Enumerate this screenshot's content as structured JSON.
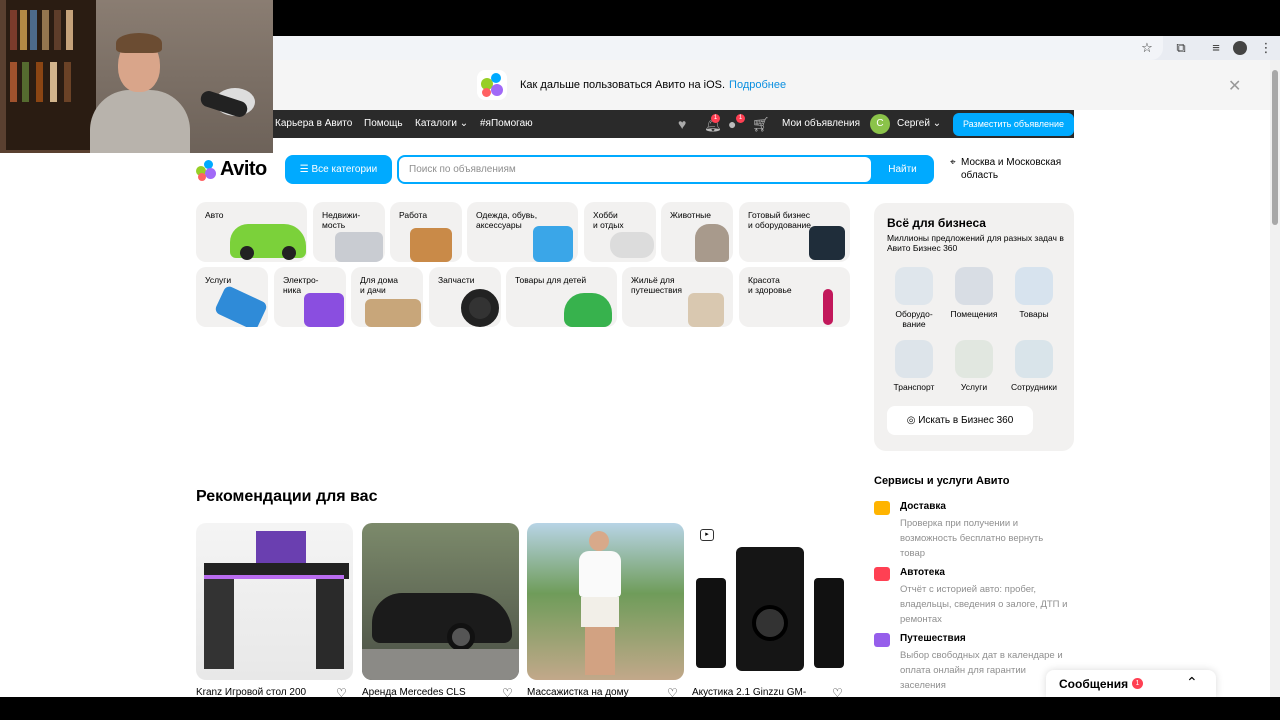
{
  "ios_banner": {
    "text": "Как дальше пользоваться Авито на iOS.",
    "link": "Подробнее"
  },
  "topnav": {
    "career": "Карьера в Авито",
    "help": "Помощь",
    "catalogs": "Каталоги ⌄",
    "hashtag": "#яПомогаю",
    "notif_badge": "1",
    "chat_badge": "1",
    "my_ads": "Мои объявления",
    "avatar_letter": "С",
    "user_name": "Сергей ⌄",
    "post_ad": "Разместить объявление"
  },
  "header": {
    "logo": "Avito",
    "all_categories": "Все категории",
    "search_placeholder": "Поиск по объявлениям",
    "search_button": "Найти",
    "location": "Москва и Московская область"
  },
  "categories": [
    {
      "label": "Авто"
    },
    {
      "label": "Недвижи-\nмость"
    },
    {
      "label": "Работа"
    },
    {
      "label": "Одежда, обувь,\nаксессуары"
    },
    {
      "label": "Хобби\nи отдых"
    },
    {
      "label": "Животные"
    },
    {
      "label": "Готовый бизнес\nи оборудование"
    },
    {
      "label": "Услуги"
    },
    {
      "label": "Электро-\nника"
    },
    {
      "label": "Для дома\nи дачи"
    },
    {
      "label": "Запчасти"
    },
    {
      "label": "Товары для детей"
    },
    {
      "label": "Жильё для\nпутешествия"
    },
    {
      "label": "Красота\nи здоровье"
    }
  ],
  "business": {
    "title": "Всё для бизнеса",
    "subtitle": "Миллионы предложений для разных задач в Авито Бизнес 360",
    "items": [
      {
        "label": "Оборудо-\nвание"
      },
      {
        "label": "Помещения"
      },
      {
        "label": "Товары"
      },
      {
        "label": "Транспорт"
      },
      {
        "label": "Услуги"
      },
      {
        "label": "Сотрудники"
      }
    ],
    "button": "Искать в Бизнес 360"
  },
  "recommendations": {
    "title": "Рекомендации для вас",
    "cards": [
      {
        "title": "Kranz Игровой стол 200"
      },
      {
        "title": "Аренда Mercedes CLS"
      },
      {
        "title": "Массажистка на дому"
      },
      {
        "title": "Акустика 2.1 Ginzzu GM-"
      }
    ]
  },
  "services": {
    "title": "Сервисы и услуги Авито",
    "items": [
      {
        "title": "Доставка",
        "desc": "Проверка при получении и возможность бесплатно вернуть товар",
        "color": "#ffb400"
      },
      {
        "title": "Автотека",
        "desc": "Отчёт с историей авто: пробег, владельцы, сведения о залоге, ДТП и ремонтах",
        "color": "#ff4053"
      },
      {
        "title": "Путешествия",
        "desc": "Выбор свободных дат в календаре и оплата онлайн для гарантии заселения",
        "color": "#965eeb"
      }
    ]
  },
  "messages": {
    "title": "Сообщения",
    "badge": "1"
  },
  "colors": {
    "accent": "#00aaff",
    "nav_bg": "#2a2a2a",
    "badge": "#ff4053"
  }
}
